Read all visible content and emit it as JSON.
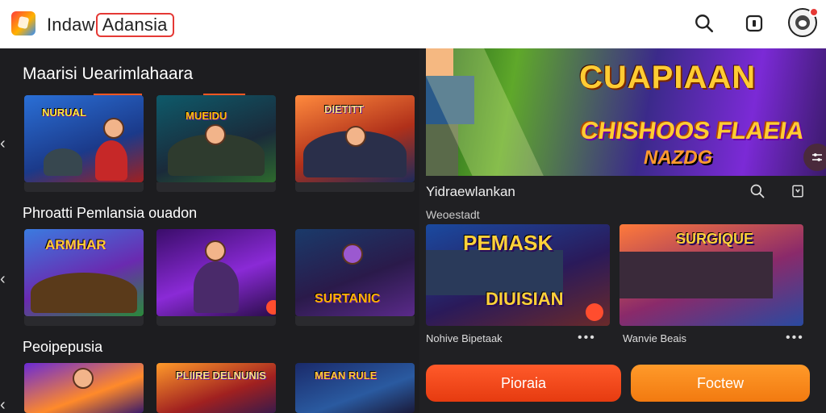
{
  "header": {
    "brand_prefix": "Indaw",
    "brand_highlight": "Adansia",
    "search_icon": "search-icon",
    "tablet_icon": "tablet-icon",
    "avatar_icon": "avatar-icon"
  },
  "left": {
    "section1": {
      "title": "Maarisi Uearimlahaara",
      "cards": [
        {
          "title": "NURUAL",
          "icon": "game-art"
        },
        {
          "title": "MUEIDU",
          "icon": "game-art"
        },
        {
          "title": "DIETITT",
          "icon": "game-art"
        }
      ]
    },
    "section2": {
      "title": "Phroatti Pemlansia ouadon",
      "cards": [
        {
          "title": "ARMHAR",
          "icon": "game-art"
        },
        {
          "title": "",
          "icon": "game-art"
        },
        {
          "title": "SURTANIC",
          "icon": "game-art"
        }
      ]
    },
    "section3": {
      "title": "Peoipepusia",
      "cards": [
        {
          "title": "",
          "icon": "game-art"
        },
        {
          "title": "PLIIRE DELNUNIS",
          "icon": "game-art"
        },
        {
          "title": "MEAN RULE",
          "icon": "game-art"
        }
      ]
    }
  },
  "right": {
    "banner": {
      "title1": "CUAPIAAN",
      "title2": "CHISHOOS FLAEIA",
      "title3": "NAZDG"
    },
    "panel_title": "Yidraewlankan",
    "panel_subtitle": "Weoestadt",
    "cards": [
      {
        "title": "PEMASK",
        "caption": "Nohive Bipetaak",
        "title2": "DIUISIAN"
      },
      {
        "title": "SURGIQUE",
        "caption": "Wanvie Beais",
        "title2": ""
      }
    ],
    "buttons": {
      "primary": "Pioraia",
      "secondary": "Foctew"
    }
  },
  "colors": {
    "accent": "#ff5722",
    "primary_button": "#ff4d1f",
    "secondary_button": "#ff8c1a",
    "badge": "#e53935"
  }
}
